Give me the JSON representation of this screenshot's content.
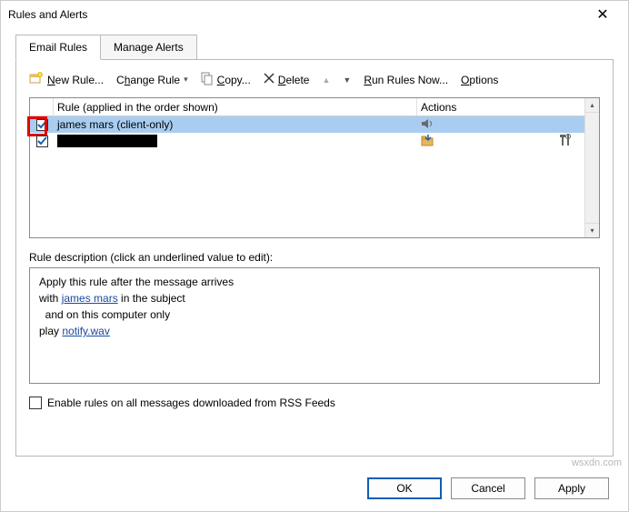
{
  "title": "Rules and Alerts",
  "tabs": {
    "email": "Email Rules",
    "alerts": "Manage Alerts"
  },
  "toolbar": {
    "new_rule": "New Rule...",
    "change_rule": "Change Rule",
    "copy": "Copy...",
    "delete": "Delete",
    "run_now": "Run Rules Now...",
    "options": "Options"
  },
  "columns": {
    "rule": "Rule (applied in the order shown)",
    "actions": "Actions"
  },
  "rules": [
    {
      "name": "james mars  (client-only)",
      "checked": true,
      "selected": true,
      "icon": "sound"
    },
    {
      "name": "",
      "checked": true,
      "selected": false,
      "icon": "folder"
    }
  ],
  "description_label": "Rule description (click an underlined value to edit):",
  "description": {
    "line1": "Apply this rule after the message arrives",
    "line2_pre": "with ",
    "line2_link": "james mars",
    "line2_post": " in the subject",
    "line3": "  and on this computer only",
    "line4_pre": "play ",
    "line4_link": "notify.wav"
  },
  "rss_label": "Enable rules on all messages downloaded from RSS Feeds",
  "buttons": {
    "ok": "OK",
    "cancel": "Cancel",
    "apply": "Apply"
  },
  "watermark": "wsxdn.com"
}
